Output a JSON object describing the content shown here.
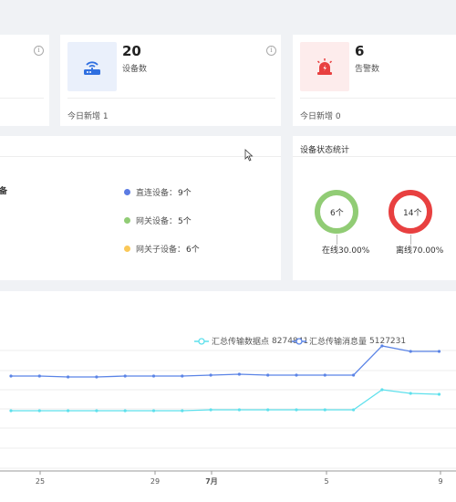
{
  "stats": [
    {
      "value": "20",
      "label": "设备数",
      "footer": "今日新增 1",
      "icon": "router-icon",
      "icon_bg": "#eaf0fb",
      "icon_color": "#2f6fe0"
    },
    {
      "value": "6",
      "label": "告警数",
      "footer": "今日新增 0",
      "icon": "alarm-icon",
      "icon_bg": "#fdecec",
      "icon_color": "#e84040"
    }
  ],
  "device_types": {
    "title_fragment": "备",
    "items": [
      {
        "label": "直连设备：",
        "count": "9个",
        "color": "#5b7be3"
      },
      {
        "label": "网关设备：",
        "count": "5个",
        "color": "#91cc75"
      },
      {
        "label": "网关子设备：",
        "count": "6个",
        "color": "#fac858"
      }
    ]
  },
  "device_status": {
    "title": "设备状态统计",
    "items": [
      {
        "center": "6个",
        "caption": "在线30.00%",
        "color": "#91cc75",
        "fraction": 0.3
      },
      {
        "center": "14个",
        "caption": "离线70.00%",
        "color": "#e84040",
        "fraction": 0.7
      }
    ]
  },
  "chart_data": {
    "type": "line",
    "legend": [
      {
        "name": "汇总传输数据点",
        "value": "8274841",
        "color": "#5ee0ec"
      },
      {
        "name": "汇总传输消息量",
        "value": "5127231",
        "color": "#5b84e6"
      }
    ],
    "x_ticks": [
      "25",
      "29",
      "7月",
      "5",
      "9"
    ],
    "series": [
      {
        "name": "汇总传输消息量",
        "values": [
          409,
          409,
          410,
          409,
          411,
          410,
          410,
          409,
          411,
          408,
          416,
          384,
          385,
          385,
          379,
          411,
          411,
          411,
          411,
          410,
          411,
          412,
          412,
          412,
          413,
          413,
          412,
          412
        ]
      },
      {
        "name": "汇总传输数据点",
        "values": [
          449,
          449,
          449,
          449,
          449,
          448,
          449,
          449,
          450,
          448,
          452,
          431,
          432,
          431,
          427,
          449,
          449,
          449,
          449,
          449,
          449,
          450,
          450,
          450,
          450,
          450,
          450,
          450
        ]
      }
    ]
  }
}
